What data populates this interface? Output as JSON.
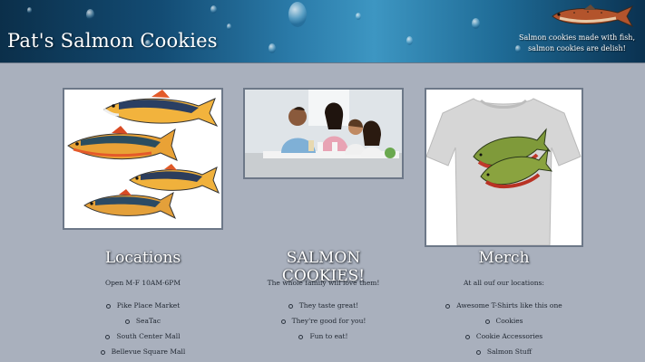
{
  "site": {
    "title": "Pat's Salmon Cookies",
    "tagline": "Salmon cookies made with fish, salmon cookies are delish!",
    "header_colors": {
      "dark": "#0b2f4a",
      "light": "#3d96c2"
    }
  },
  "columns": [
    {
      "image": "salmon-illustrations-image",
      "heading": "Locations",
      "subtitle": "Open M-F 10AM-6PM",
      "items": [
        "Pike Place Market",
        "SeaTac",
        "South Center Mall",
        "Bellevue Square Mall"
      ]
    },
    {
      "image": "family-photo-image",
      "heading": "SALMON COOKIES!",
      "subtitle": "The whole family will love them!",
      "items": [
        "They taste great!",
        "They're good for you!",
        "Fun to eat!"
      ]
    },
    {
      "image": "salmon-tshirt-image",
      "heading": "Merch",
      "subtitle": "At all ouf our locations:",
      "items": [
        "Awesome T-Shirts like this one",
        "Cookies",
        "Cookie Accessories",
        "Salmon Stuff"
      ]
    }
  ]
}
